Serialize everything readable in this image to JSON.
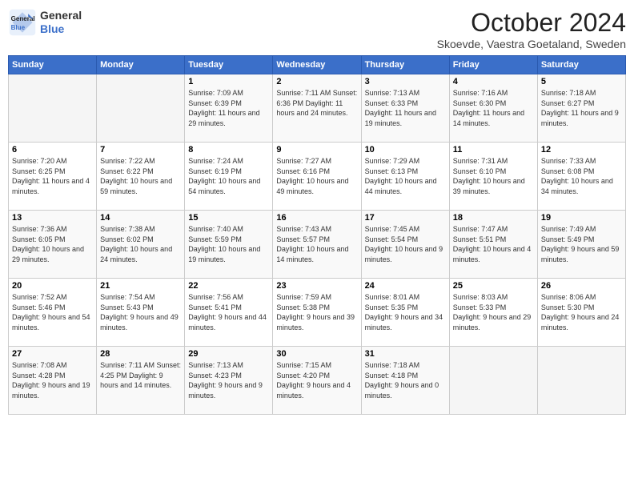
{
  "header": {
    "logo_line1": "General",
    "logo_line2": "Blue",
    "month": "October 2024",
    "location": "Skoevde, Vaestra Goetaland, Sweden"
  },
  "days_of_week": [
    "Sunday",
    "Monday",
    "Tuesday",
    "Wednesday",
    "Thursday",
    "Friday",
    "Saturday"
  ],
  "weeks": [
    [
      {
        "day": "",
        "info": ""
      },
      {
        "day": "",
        "info": ""
      },
      {
        "day": "1",
        "info": "Sunrise: 7:09 AM\nSunset: 6:39 PM\nDaylight: 11 hours and 29 minutes."
      },
      {
        "day": "2",
        "info": "Sunrise: 7:11 AM\nSunset: 6:36 PM\nDaylight: 11 hours and 24 minutes."
      },
      {
        "day": "3",
        "info": "Sunrise: 7:13 AM\nSunset: 6:33 PM\nDaylight: 11 hours and 19 minutes."
      },
      {
        "day": "4",
        "info": "Sunrise: 7:16 AM\nSunset: 6:30 PM\nDaylight: 11 hours and 14 minutes."
      },
      {
        "day": "5",
        "info": "Sunrise: 7:18 AM\nSunset: 6:27 PM\nDaylight: 11 hours and 9 minutes."
      }
    ],
    [
      {
        "day": "6",
        "info": "Sunrise: 7:20 AM\nSunset: 6:25 PM\nDaylight: 11 hours and 4 minutes."
      },
      {
        "day": "7",
        "info": "Sunrise: 7:22 AM\nSunset: 6:22 PM\nDaylight: 10 hours and 59 minutes."
      },
      {
        "day": "8",
        "info": "Sunrise: 7:24 AM\nSunset: 6:19 PM\nDaylight: 10 hours and 54 minutes."
      },
      {
        "day": "9",
        "info": "Sunrise: 7:27 AM\nSunset: 6:16 PM\nDaylight: 10 hours and 49 minutes."
      },
      {
        "day": "10",
        "info": "Sunrise: 7:29 AM\nSunset: 6:13 PM\nDaylight: 10 hours and 44 minutes."
      },
      {
        "day": "11",
        "info": "Sunrise: 7:31 AM\nSunset: 6:10 PM\nDaylight: 10 hours and 39 minutes."
      },
      {
        "day": "12",
        "info": "Sunrise: 7:33 AM\nSunset: 6:08 PM\nDaylight: 10 hours and 34 minutes."
      }
    ],
    [
      {
        "day": "13",
        "info": "Sunrise: 7:36 AM\nSunset: 6:05 PM\nDaylight: 10 hours and 29 minutes."
      },
      {
        "day": "14",
        "info": "Sunrise: 7:38 AM\nSunset: 6:02 PM\nDaylight: 10 hours and 24 minutes."
      },
      {
        "day": "15",
        "info": "Sunrise: 7:40 AM\nSunset: 5:59 PM\nDaylight: 10 hours and 19 minutes."
      },
      {
        "day": "16",
        "info": "Sunrise: 7:43 AM\nSunset: 5:57 PM\nDaylight: 10 hours and 14 minutes."
      },
      {
        "day": "17",
        "info": "Sunrise: 7:45 AM\nSunset: 5:54 PM\nDaylight: 10 hours and 9 minutes."
      },
      {
        "day": "18",
        "info": "Sunrise: 7:47 AM\nSunset: 5:51 PM\nDaylight: 10 hours and 4 minutes."
      },
      {
        "day": "19",
        "info": "Sunrise: 7:49 AM\nSunset: 5:49 PM\nDaylight: 9 hours and 59 minutes."
      }
    ],
    [
      {
        "day": "20",
        "info": "Sunrise: 7:52 AM\nSunset: 5:46 PM\nDaylight: 9 hours and 54 minutes."
      },
      {
        "day": "21",
        "info": "Sunrise: 7:54 AM\nSunset: 5:43 PM\nDaylight: 9 hours and 49 minutes."
      },
      {
        "day": "22",
        "info": "Sunrise: 7:56 AM\nSunset: 5:41 PM\nDaylight: 9 hours and 44 minutes."
      },
      {
        "day": "23",
        "info": "Sunrise: 7:59 AM\nSunset: 5:38 PM\nDaylight: 9 hours and 39 minutes."
      },
      {
        "day": "24",
        "info": "Sunrise: 8:01 AM\nSunset: 5:35 PM\nDaylight: 9 hours and 34 minutes."
      },
      {
        "day": "25",
        "info": "Sunrise: 8:03 AM\nSunset: 5:33 PM\nDaylight: 9 hours and 29 minutes."
      },
      {
        "day": "26",
        "info": "Sunrise: 8:06 AM\nSunset: 5:30 PM\nDaylight: 9 hours and 24 minutes."
      }
    ],
    [
      {
        "day": "27",
        "info": "Sunrise: 7:08 AM\nSunset: 4:28 PM\nDaylight: 9 hours and 19 minutes."
      },
      {
        "day": "28",
        "info": "Sunrise: 7:11 AM\nSunset: 4:25 PM\nDaylight: 9 hours and 14 minutes."
      },
      {
        "day": "29",
        "info": "Sunrise: 7:13 AM\nSunset: 4:23 PM\nDaylight: 9 hours and 9 minutes."
      },
      {
        "day": "30",
        "info": "Sunrise: 7:15 AM\nSunset: 4:20 PM\nDaylight: 9 hours and 4 minutes."
      },
      {
        "day": "31",
        "info": "Sunrise: 7:18 AM\nSunset: 4:18 PM\nDaylight: 9 hours and 0 minutes."
      },
      {
        "day": "",
        "info": ""
      },
      {
        "day": "",
        "info": ""
      }
    ]
  ]
}
